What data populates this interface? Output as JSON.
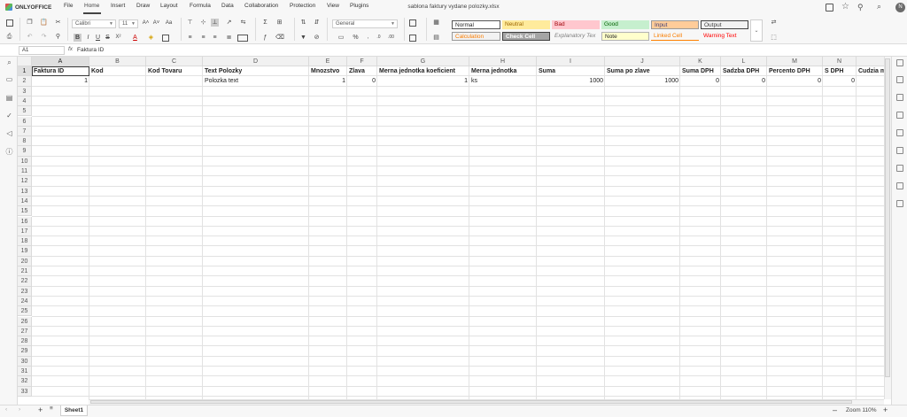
{
  "app": {
    "name": "ONLYOFFICE",
    "doc_title": "sablona faktury vydane polozky.xlsx",
    "user_initial": "N"
  },
  "menu": [
    "File",
    "Home",
    "Insert",
    "Draw",
    "Layout",
    "Formula",
    "Data",
    "Collaboration",
    "Protection",
    "View",
    "Plugins"
  ],
  "toolbar": {
    "font_name": "Calibri",
    "font_size": "11",
    "number_format": "General"
  },
  "cell_styles": {
    "normal": "Normal",
    "neutral": "Neutral",
    "bad": "Bad",
    "good": "Good",
    "input": "Input",
    "output": "Output",
    "calculation": "Calculation",
    "check_cell": "Check Cell",
    "explanatory": "Explanatory Tex",
    "note": "Note",
    "linked_cell": "Linked Cell",
    "warning": "Warning Text"
  },
  "formula_bar": {
    "name_box": "A1",
    "fx": "fx",
    "value": "Faktura ID"
  },
  "columns": [
    "A",
    "B",
    "C",
    "D",
    "E",
    "F",
    "G",
    "H",
    "I",
    "J",
    "K",
    "L",
    "M",
    "N",
    ""
  ],
  "rows": [
    "1",
    "2",
    "3",
    "4",
    "5",
    "6",
    "7",
    "8",
    "9",
    "10",
    "11",
    "12",
    "13",
    "14",
    "15",
    "16",
    "17",
    "18",
    "19",
    "20",
    "21",
    "22",
    "23",
    "24",
    "25",
    "26",
    "27",
    "28",
    "29",
    "30",
    "31",
    "32",
    "33"
  ],
  "headers": [
    "Faktura ID",
    "Kod",
    "Kod Tovaru",
    "Text Polozky",
    "Mnozstvo",
    "Zlava",
    "Merna jednotka koeficient",
    "Merna jednotka",
    "Suma",
    "Suma po zlave",
    "Suma DPH",
    "Sadzba DPH",
    "Percento DPH",
    "S DPH",
    "Cudzia m"
  ],
  "row2": [
    "1",
    "",
    "",
    "Polozka text",
    "1",
    "0",
    "1",
    "ks",
    "1000",
    "1000",
    "0",
    "0",
    "0",
    "0",
    ""
  ],
  "status": {
    "sheet": "Sheet1",
    "zoom": "Zoom 110%"
  }
}
